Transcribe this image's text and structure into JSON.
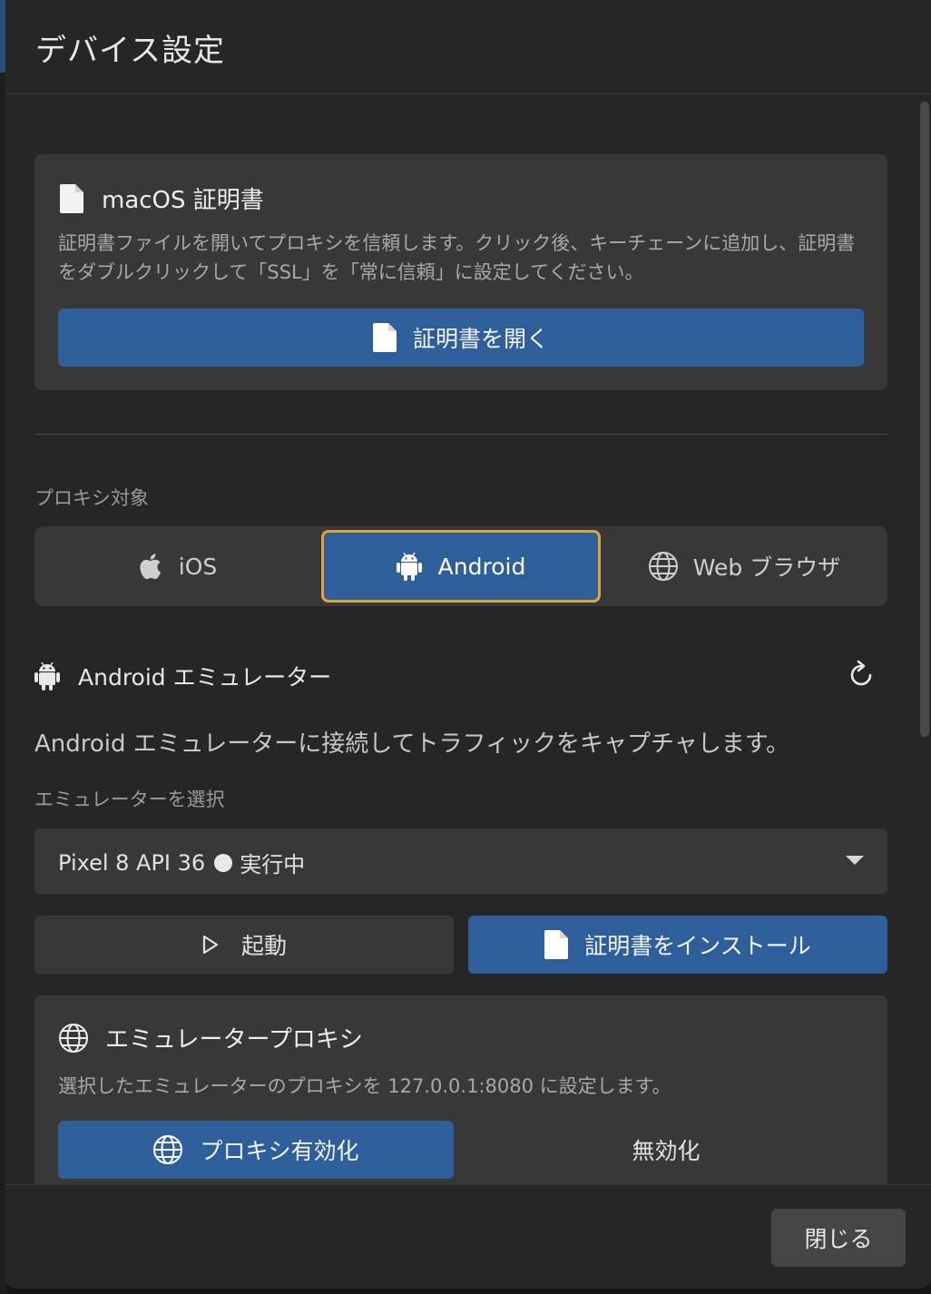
{
  "dialog": {
    "title": "デバイス設定",
    "close_label": "閉じる"
  },
  "macos": {
    "title": "macOS 証明書",
    "description": "証明書ファイルを開いてプロキシを信頼します。クリック後、キーチェーンに追加し、証明書をダブルクリックして「SSL」を「常に信頼」に設定してください。",
    "open_button": "証明書を開く"
  },
  "proxy_target": {
    "label": "プロキシ対象",
    "options": [
      "iOS",
      "Android",
      "Web ブラウザ"
    ],
    "selected": "Android"
  },
  "emulator": {
    "title": "Android エミュレーター",
    "description": "Android エミュレーターに接続してトラフィックをキャプチャします。",
    "select_label": "エミュレーターを選択",
    "selected_device": "Pixel 8 API 36",
    "selected_status": "実行中",
    "start_button": "起動",
    "install_cert_button": "証明書をインストール"
  },
  "emulator_proxy": {
    "title": "エミュレータープロキシ",
    "description": "選択したエミュレーターのプロキシを 127.0.0.1:8080 に設定します。",
    "enable_button": "プロキシ有効化",
    "disable_button": "無効化"
  },
  "colors": {
    "accent": "#2e5f9b",
    "focus_ring": "#e0a53a",
    "surface": "#383838",
    "background": "#262626"
  },
  "icons": {
    "file": "file-icon",
    "apple": "apple-icon",
    "android": "android-icon",
    "globe": "globe-icon",
    "refresh": "refresh-icon",
    "play": "play-icon",
    "caret": "chevron-down-icon"
  }
}
